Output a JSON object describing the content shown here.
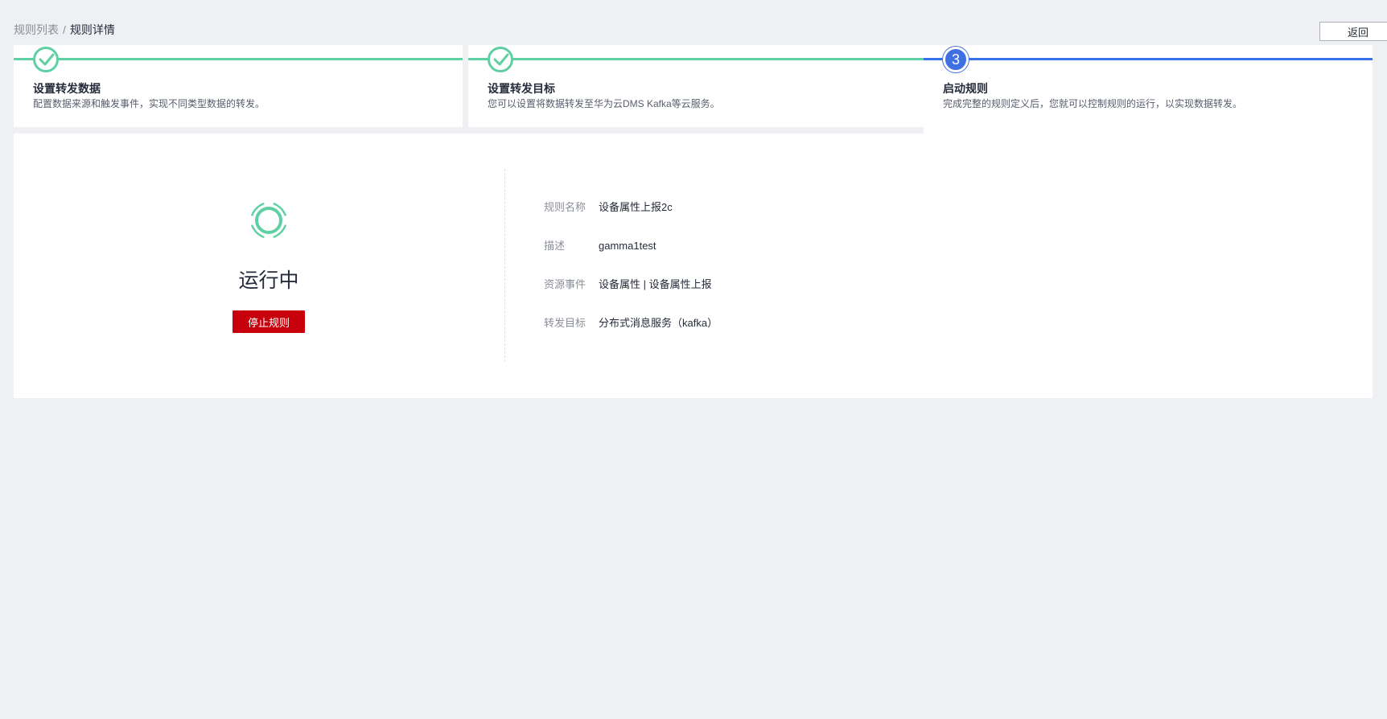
{
  "breadcrumb": {
    "parent": "规则列表",
    "separator": "/",
    "current": "规则详情"
  },
  "header": {
    "back_label": "返回"
  },
  "steps": [
    {
      "status": "done",
      "title": "设置转发数据",
      "description": "配置数据来源和触发事件，实现不同类型数据的转发。"
    },
    {
      "status": "done",
      "title": "设置转发目标",
      "description": "您可以设置将数据转发至华为云DMS Kafka等云服务。"
    },
    {
      "status": "active",
      "number": "3",
      "title": "启动规则",
      "description": "完成完整的规则定义后，您就可以控制规则的运行，以实现数据转发。"
    }
  ],
  "status": {
    "text": "运行中",
    "stop_label": "停止规则"
  },
  "info": [
    {
      "label": "规则名称",
      "value": "设备属性上报2c"
    },
    {
      "label": "描述",
      "value": "gamma1test"
    },
    {
      "label": "资源事件",
      "value": "设备属性 | 设备属性上报"
    },
    {
      "label": "转发目标",
      "value": "分布式消息服务（kafka）"
    }
  ],
  "colors": {
    "background": "#eff0f4",
    "done": "#5fcfa4",
    "active": "#3e6fe3",
    "danger": "#c7000b"
  }
}
